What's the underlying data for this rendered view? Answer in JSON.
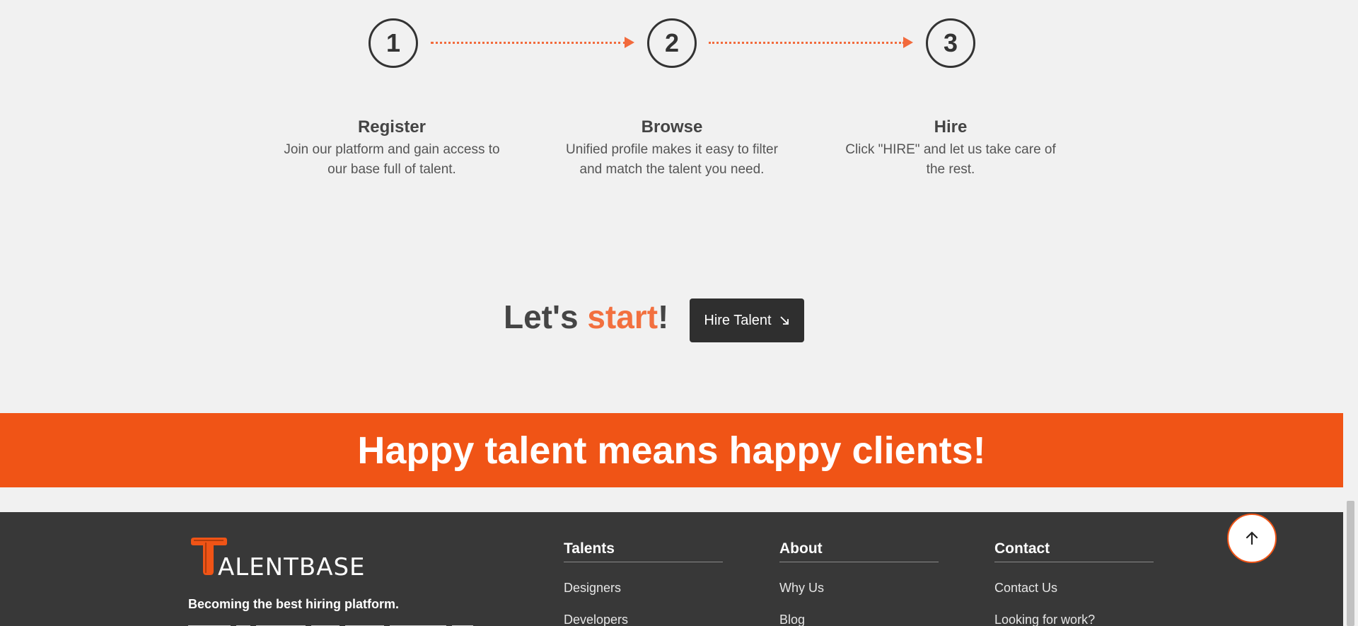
{
  "steps": [
    {
      "number": "1",
      "title": "Register",
      "desc_line1": "Join our platform and gain access to",
      "desc_line2": "our base full of talent."
    },
    {
      "number": "2",
      "title": "Browse",
      "desc_line1": "Unified profile makes it easy to filter",
      "desc_line2": "and match the talent you need."
    },
    {
      "number": "3",
      "title": "Hire",
      "desc_line1": "Click \"HIRE\" and let us take care of",
      "desc_line2": "the rest."
    }
  ],
  "cta": {
    "heading_pre": "Let's ",
    "heading_accent": "start",
    "heading_post": "!",
    "button_label": "Hire Talent",
    "button_icon": "arrow-down-right-icon"
  },
  "banner": {
    "text": "Happy talent means happy clients!"
  },
  "footer": {
    "logo_text": "ALENTBASE",
    "tagline": "Becoming the best hiring platform.",
    "columns": [
      {
        "title": "Talents",
        "links": [
          "Designers",
          "Developers"
        ]
      },
      {
        "title": "About",
        "links": [
          "Why Us",
          "Blog"
        ]
      },
      {
        "title": "Contact",
        "links": [
          "Contact Us",
          "Looking for work?"
        ]
      }
    ]
  },
  "scroll_top": {
    "icon": "arrow-up-icon"
  },
  "colors": {
    "accent": "#f2703f",
    "banner": "#f05416",
    "dark": "#2f2f2f",
    "footer_bg": "#383838"
  }
}
